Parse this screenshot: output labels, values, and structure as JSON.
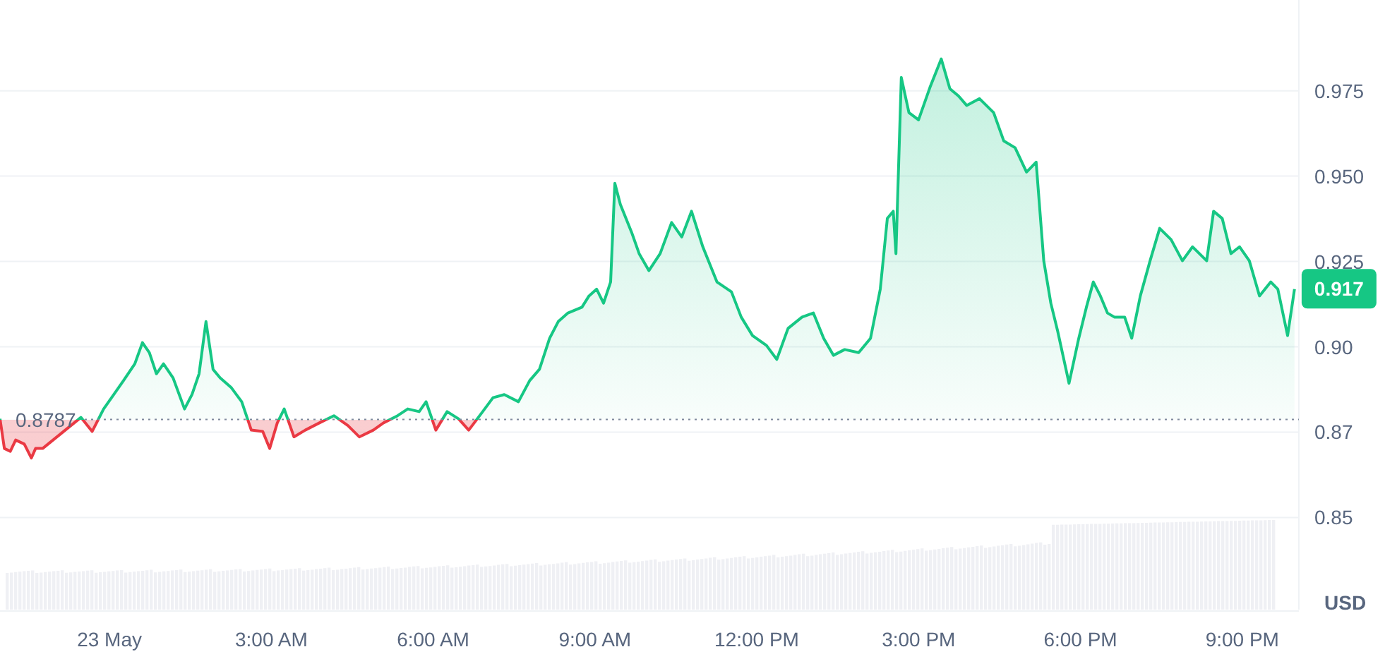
{
  "chart": {
    "chart_data": {
      "type": "area",
      "ylabel": "USD",
      "x": [
        -2.03,
        -1.95,
        -1.84,
        -1.74,
        -1.58,
        -1.45,
        -1.37,
        -1.24,
        -0.53,
        -0.32,
        -0.11,
        0.08,
        0.26,
        0.47,
        0.61,
        0.74,
        0.87,
        1.0,
        1.18,
        1.39,
        1.53,
        1.66,
        1.79,
        1.92,
        2.05,
        2.26,
        2.45,
        2.63,
        2.84,
        2.97,
        3.11,
        3.24,
        3.42,
        3.63,
        3.89,
        4.16,
        4.42,
        4.63,
        4.89,
        5.08,
        5.34,
        5.53,
        5.74,
        5.87,
        6.05,
        6.26,
        6.47,
        6.66,
        6.92,
        7.11,
        7.32,
        7.58,
        7.79,
        7.97,
        8.16,
        8.32,
        8.5,
        8.76,
        8.89,
        9.03,
        9.16,
        9.29,
        9.37,
        9.47,
        9.68,
        9.82,
        10.0,
        10.21,
        10.42,
        10.61,
        10.79,
        11.0,
        11.26,
        11.53,
        11.71,
        11.92,
        12.18,
        12.37,
        12.58,
        12.84,
        13.05,
        13.24,
        13.42,
        13.63,
        13.89,
        14.11,
        14.29,
        14.42,
        14.53,
        14.58,
        14.68,
        14.82,
        15.0,
        15.21,
        15.42,
        15.58,
        15.74,
        15.89,
        16.13,
        16.39,
        16.58,
        16.79,
        17.0,
        17.18,
        17.32,
        17.45,
        17.58,
        17.79,
        17.97,
        18.11,
        18.24,
        18.37,
        18.5,
        18.63,
        18.82,
        18.95,
        19.11,
        19.29,
        19.47,
        19.68,
        19.89,
        20.08,
        20.34,
        20.47,
        20.63,
        20.79,
        20.95,
        21.13,
        21.32,
        21.53,
        21.66,
        21.84,
        21.97
      ],
      "series": [
        {
          "color": "#16c784",
          "values": [
            0.8789,
            0.8702,
            0.8694,
            0.8727,
            0.8715,
            0.8674,
            0.8702,
            0.8702,
            0.8793,
            0.8752,
            0.8818,
            0.886,
            0.8901,
            0.895,
            0.9012,
            0.8983,
            0.8921,
            0.895,
            0.8909,
            0.8818,
            0.886,
            0.8921,
            0.9074,
            0.8934,
            0.8909,
            0.888,
            0.8839,
            0.8756,
            0.8752,
            0.8702,
            0.8777,
            0.8818,
            0.8736,
            0.8756,
            0.8777,
            0.8798,
            0.8769,
            0.8736,
            0.8756,
            0.8777,
            0.8798,
            0.8818,
            0.881,
            0.8839,
            0.8756,
            0.881,
            0.8789,
            0.8756,
            0.881,
            0.8851,
            0.886,
            0.8839,
            0.8901,
            0.8934,
            0.9025,
            0.9074,
            0.9099,
            0.9116,
            0.9149,
            0.9169,
            0.9128,
            0.919,
            0.9479,
            0.9417,
            0.9335,
            0.9273,
            0.9223,
            0.9273,
            0.9364,
            0.9322,
            0.9397,
            0.9293,
            0.919,
            0.9161,
            0.9087,
            0.9033,
            0.9004,
            0.8963,
            0.9054,
            0.9087,
            0.9099,
            0.9025,
            0.8975,
            0.8992,
            0.8983,
            0.9025,
            0.9169,
            0.9376,
            0.9397,
            0.9273,
            0.9789,
            0.9686,
            0.9665,
            0.976,
            0.9843,
            0.9756,
            0.9735,
            0.9707,
            0.9727,
            0.9686,
            0.9603,
            0.9583,
            0.9512,
            0.9541,
            0.9252,
            0.9128,
            0.9045,
            0.8893,
            0.9025,
            0.9116,
            0.919,
            0.9149,
            0.9099,
            0.9087,
            0.9087,
            0.9025,
            0.9149,
            0.9252,
            0.9347,
            0.9314,
            0.9252,
            0.9293,
            0.9252,
            0.9397,
            0.9376,
            0.9273,
            0.9293,
            0.9252,
            0.9149,
            0.919,
            0.9169,
            0.9033,
            0.9169
          ]
        }
      ],
      "xlim": [
        -2.03,
        22.05
      ],
      "ylim": [
        0.823,
        1.0016
      ],
      "xticks": [
        {
          "value": 0,
          "label": "23 May"
        },
        {
          "value": 3,
          "label": "3:00 AM"
        },
        {
          "value": 6,
          "label": "6:00 AM"
        },
        {
          "value": 9,
          "label": "9:00 AM"
        },
        {
          "value": 12,
          "label": "12:00 PM"
        },
        {
          "value": 15,
          "label": "3:00 PM"
        },
        {
          "value": 18,
          "label": "6:00 PM"
        },
        {
          "value": 21,
          "label": "9:00 PM"
        }
      ],
      "yticks": [
        {
          "value": 0.85,
          "label": "0.85"
        },
        {
          "value": 0.875,
          "label": "0.87"
        },
        {
          "value": 0.9,
          "label": "0.90"
        },
        {
          "value": 0.925,
          "label": "0.925"
        },
        {
          "value": 0.95,
          "label": "0.950"
        },
        {
          "value": 0.975,
          "label": "0.975"
        }
      ],
      "grid": true,
      "ref_lines": [
        {
          "axis": "y",
          "value": 0.8787,
          "label": "0.8787"
        }
      ],
      "annotations": [
        {
          "x": 21.97,
          "y": 0.917,
          "text": "0.917"
        }
      ]
    }
  }
}
